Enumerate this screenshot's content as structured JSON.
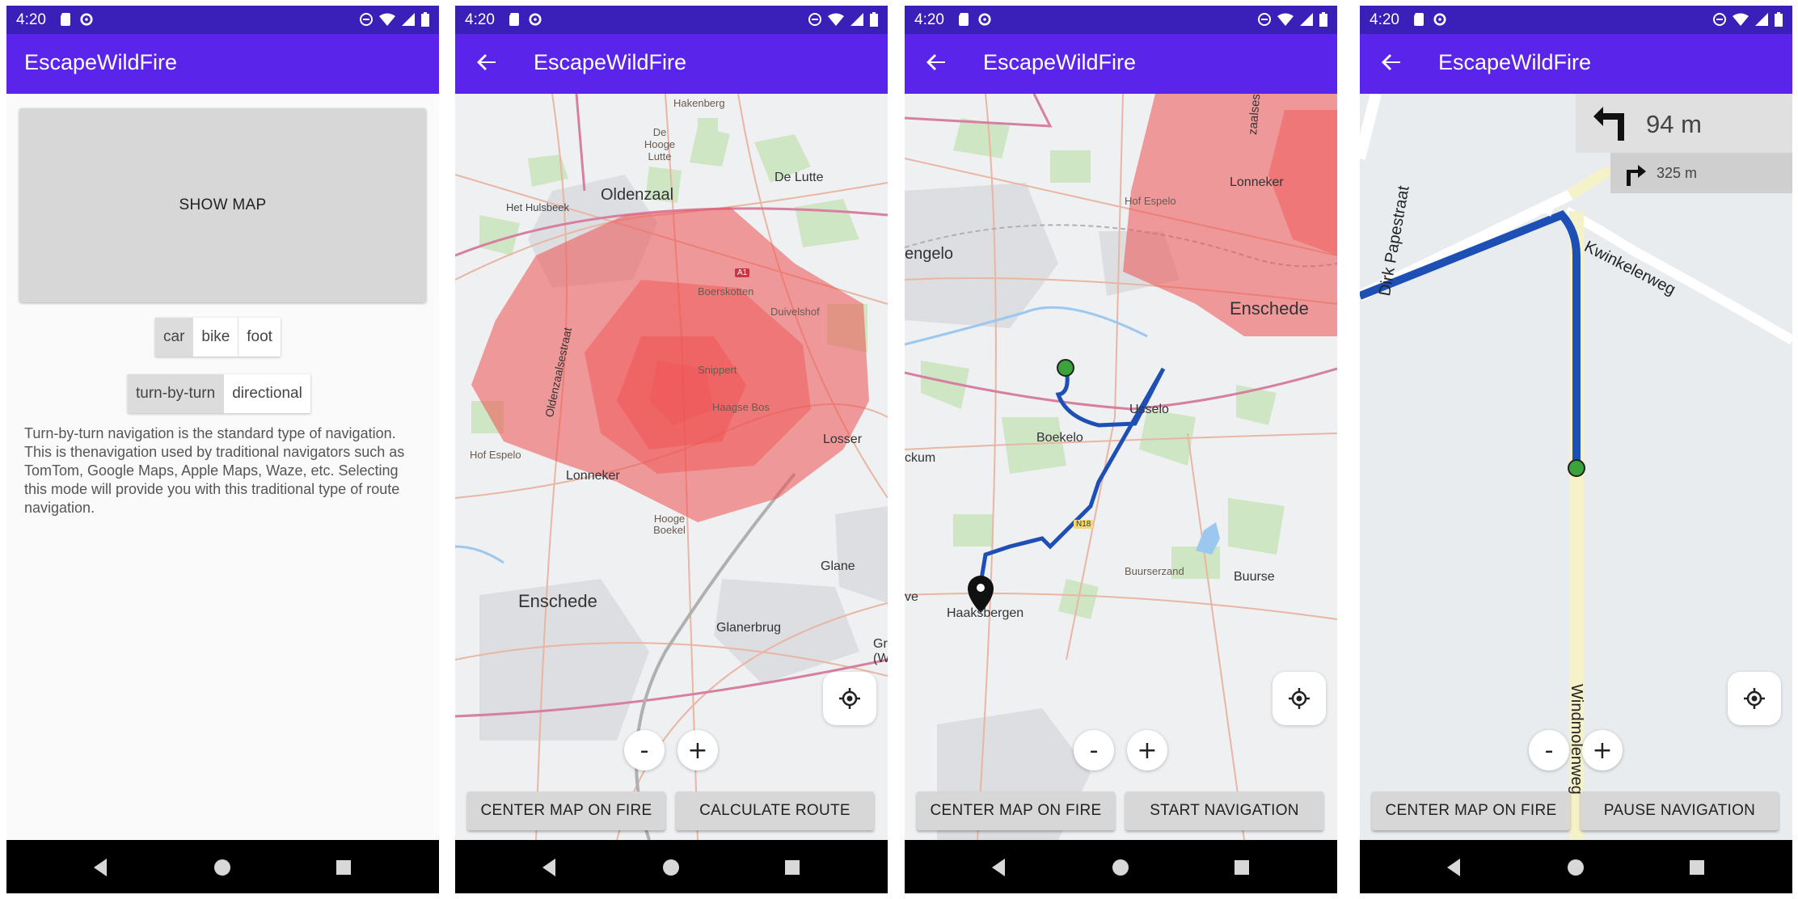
{
  "status": {
    "time": "4:20"
  },
  "app": {
    "title": "EscapeWildFire"
  },
  "screen1": {
    "show_map_label": "SHOW MAP",
    "transport_modes": [
      "car",
      "bike",
      "foot"
    ],
    "selected_transport": "car",
    "nav_modes": [
      "turn-by-turn",
      "directional"
    ],
    "selected_nav": "turn-by-turn",
    "description": "Turn-by-turn navigation is the standard type of navigation. This is thenavigation used by traditional navigators such as TomTom, Google Maps, Apple Maps, Waze, etc. Selecting this mode will provide you with this traditional type of route navigation."
  },
  "screen2": {
    "labels": {
      "hakenberg": "Hakenberg",
      "de_hooge_lutte": "De Hooge Lutte",
      "de_lutte": "De Lutte",
      "oldenzaal": "Oldenzaal",
      "het_hulsbeek": "Het Hulsbeek",
      "a1": "A1",
      "boerskotten": "Boerskotten",
      "duivelshof": "Duivelshof",
      "snippert": "Snippert",
      "haagse_bos": "Haagse Bos",
      "oldenzaalsestraat": "Oldenzaalsestraat",
      "losser": "Losser",
      "hof_espelo": "Hof Espelo",
      "lonneker": "Lonneker",
      "hooge_boekel": "Hooge Boekel",
      "glane": "Glane",
      "enschede": "Enschede",
      "glanerbrug": "Glanerbrug",
      "gr_wes": "Gr (Wes"
    },
    "zoom_out": "-",
    "zoom_in": "+",
    "center_label": "CENTER MAP ON FIRE",
    "action_label": "CALCULATE ROUTE"
  },
  "screen3": {
    "labels": {
      "zaalsestraat": "zaalsestraat",
      "lonneker": "Lonneker",
      "hof_espelo": "Hof Espelo",
      "hengelo": "engelo",
      "enschede": "Enschede",
      "usselo": "Usselo",
      "boekelo": "Boekelo",
      "ckum": "ckum",
      "n18": "N18",
      "buurserzand": "Buurserzand",
      "buurse": "Buurse",
      "ve": "ve",
      "haaksbergen": "Haaksbergen"
    },
    "zoom_out": "-",
    "zoom_in": "+",
    "center_label": "CENTER MAP ON FIRE",
    "action_label": "START NAVIGATION"
  },
  "screen4": {
    "next_turn_distance": "94 m",
    "then_turn_distance": "325 m",
    "labels": {
      "dirk_papestraat": "Dirk Papestraat",
      "kwinkelerweg": "Kwinkelerweg",
      "windmolenweg": "Windmolenweg"
    },
    "zoom_out": "-",
    "zoom_in": "+",
    "center_label": "CENTER MAP ON FIRE",
    "action_label": "PAUSE NAVIGATION"
  },
  "colors": {
    "status_bar": "#3a1fb8",
    "app_bar": "#5b24ea",
    "fire": "#f05050",
    "route": "#1e4fb5",
    "start_marker": "#3aa33a"
  }
}
